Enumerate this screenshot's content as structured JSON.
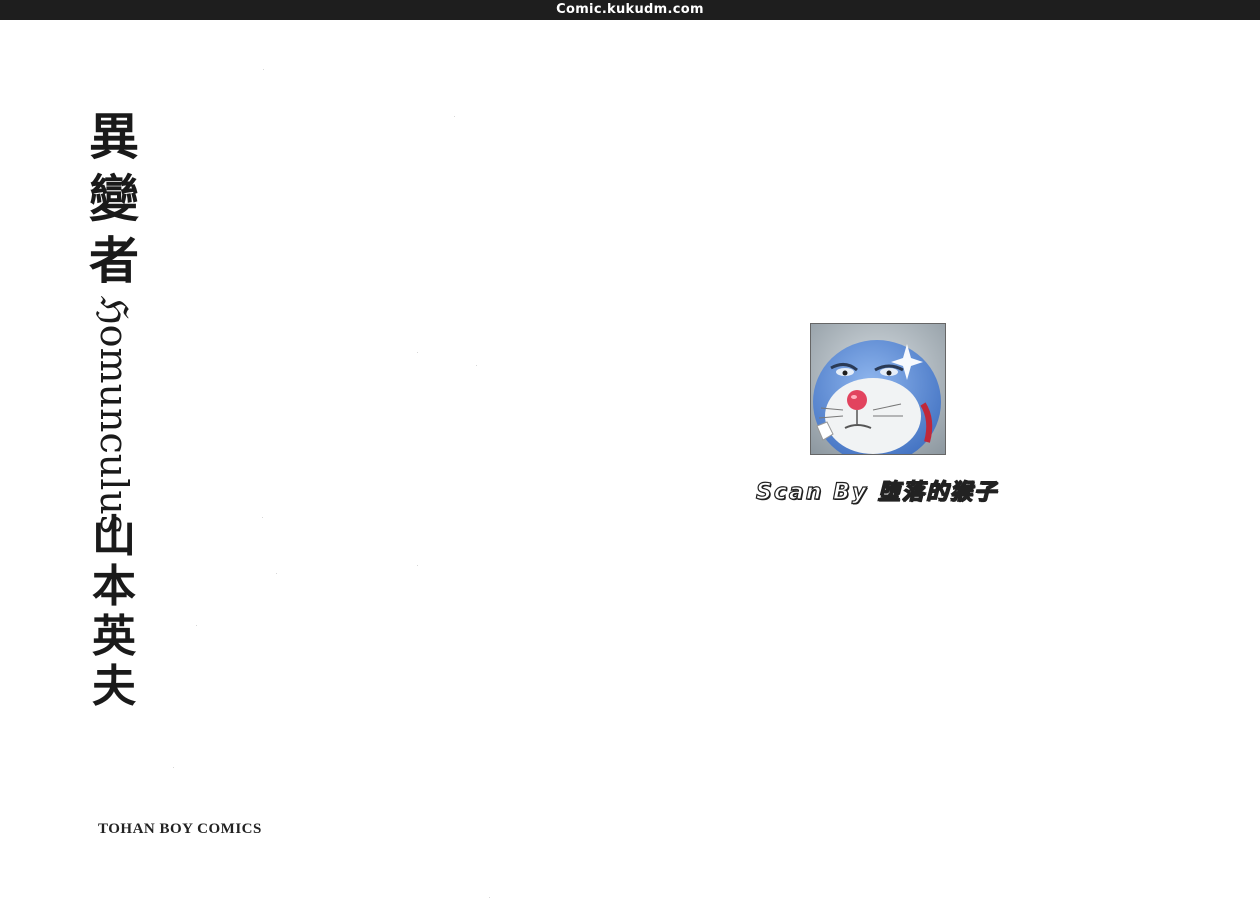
{
  "header": {
    "site_label": "Comic.kukudm.com"
  },
  "cover": {
    "title_kanji": [
      "異",
      "變",
      "者"
    ],
    "title_latin": "ℌomunculus",
    "author_kanji": [
      "山",
      "本",
      "英",
      "夫"
    ],
    "publisher": "TOHAN BOY COMICS"
  },
  "credit": {
    "avatar_icon": "blue-cat-avatar-icon",
    "scan_text": "Scan By 堕落的猴子"
  },
  "colors": {
    "top_bar": "#1e1e1e",
    "text_dark": "#1a1a1a",
    "avatar_blue": "#5b8ed6"
  }
}
